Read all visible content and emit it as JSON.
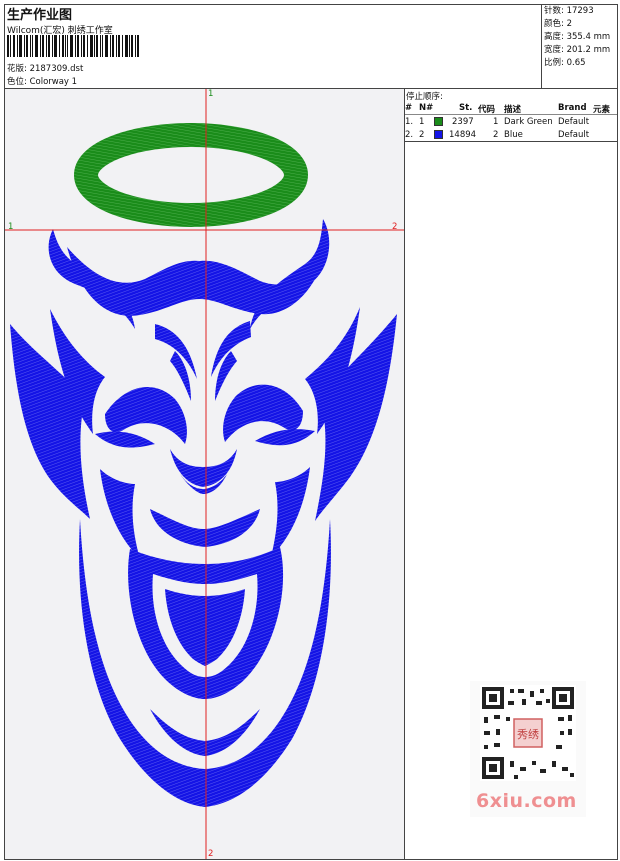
{
  "header": {
    "title": "生产作业图",
    "company": "Wilcom(汇宏) 刺绣工作室",
    "design_label": "花版:",
    "design_value": "2187309.dst",
    "colorway_label": "色位:",
    "colorway_value": "Colorway 1"
  },
  "stats": [
    {
      "label": "针数:",
      "value": "17293"
    },
    {
      "label": "颜色:",
      "value": "2"
    },
    {
      "label": "高度:",
      "value": "355.4 mm"
    },
    {
      "label": "宽度:",
      "value": "201.2 mm"
    },
    {
      "label": "比例:",
      "value": "0.65"
    }
  ],
  "stop_sequence": {
    "title": "停止顺序:",
    "columns": [
      "#",
      "N#",
      "St.",
      "代码",
      "描述",
      "Brand",
      "元素"
    ],
    "rows": [
      {
        "index": "1.",
        "needle": "1",
        "color": "#1a8c1a",
        "stitches": "2397",
        "code": "1",
        "description": "Dark Green",
        "brand": "Default"
      },
      {
        "index": "2.",
        "needle": "2",
        "color": "#1414e6",
        "stitches": "14894",
        "code": "2",
        "description": "Blue",
        "brand": "Default"
      }
    ]
  },
  "axis_markers": {
    "left": "1",
    "right": "2",
    "top": "1",
    "bottom": "2"
  },
  "watermark": {
    "text": "6xiu.com",
    "seal": "秀绣"
  },
  "colors": {
    "green": "#1a8c1a",
    "blue": "#1414e6",
    "crosshair": "#e02020",
    "watermark": "#ef8f91"
  }
}
